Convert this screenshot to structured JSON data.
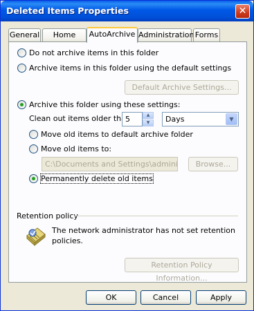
{
  "window": {
    "title": "Deleted Items Properties"
  },
  "tabs": [
    {
      "label": "General"
    },
    {
      "label": "Home Page"
    },
    {
      "label": "AutoArchive"
    },
    {
      "label": "Administration"
    },
    {
      "label": "Forms"
    }
  ],
  "archive": {
    "opt_no_archive": "Do not archive items in this folder",
    "opt_default": "Archive items in this folder using the default settings",
    "default_settings_button": "Default Archive Settings...",
    "opt_these_settings": "Archive this folder using these settings:",
    "clean_label": "Clean out items older than",
    "age_value": "5",
    "age_unit": "Days",
    "move_default": "Move old items to default archive folder",
    "move_to": "Move old items to:",
    "path_value": "C:\\Documents and Settings\\administrato",
    "browse_button": "Browse...",
    "perm_delete": "Permanently delete old items"
  },
  "retention": {
    "heading": "Retention policy",
    "message_line1": "The network administrator has not set retention",
    "message_line2": "policies.",
    "info_button": "Retention Policy Information..."
  },
  "footer": {
    "ok": "OK",
    "cancel": "Cancel",
    "apply": "Apply"
  },
  "colors": {
    "titlebar": "#0058e6",
    "dialog_bg": "#ece9d8",
    "active_tab_accent": "#ffc83c",
    "radio_check": "#21a121"
  }
}
